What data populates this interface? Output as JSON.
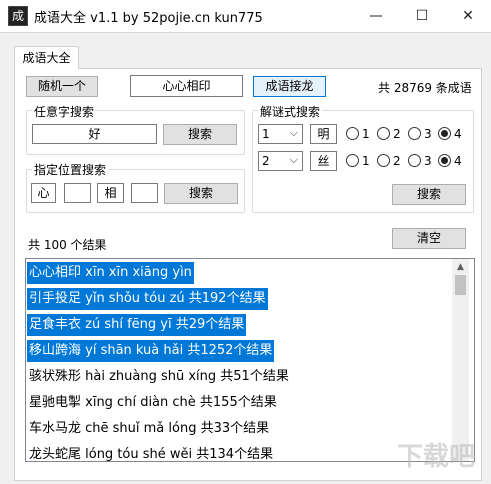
{
  "window": {
    "title": "成语大全 v1.1 by 52pojie.cn kun775",
    "icon_glyph": "成"
  },
  "tab": {
    "label": "成语大全"
  },
  "top": {
    "random_label": "随机一个",
    "current_idiom": "心心相印",
    "chain_label": "成语接龙",
    "total_text": "共 28769 条成语"
  },
  "any_char": {
    "title": "任意字搜索",
    "value": "好",
    "button": "搜索"
  },
  "position": {
    "title": "指定位置搜索",
    "slots": [
      "心",
      "",
      "相",
      ""
    ],
    "button": "搜索"
  },
  "riddle": {
    "title": "解谜式搜索",
    "rows": [
      {
        "count": "1",
        "char": "明",
        "options": [
          "1",
          "2",
          "3",
          "4"
        ],
        "selected": "4"
      },
      {
        "count": "2",
        "char": "丝",
        "options": [
          "1",
          "2",
          "3",
          "4"
        ],
        "selected": "4"
      }
    ],
    "button": "搜索"
  },
  "results": {
    "count_text": "共 100 个结果",
    "clear_label": "清空",
    "items": [
      {
        "text": "心心相印 xīn xīn xiāng yìn",
        "selected": true
      },
      {
        "text": "引手投足 yǐn shǒu tóu zú   共192个结果",
        "selected": true
      },
      {
        "text": "足食丰衣 zú shí fēng yī   共29个结果",
        "selected": true
      },
      {
        "text": "移山跨海 yí shān kuà hǎi   共1252个结果",
        "selected": true
      },
      {
        "text": "骇状殊形 hài zhuàng shū xíng   共51个结果",
        "selected": false
      },
      {
        "text": "星驰电掣 xīng chí diàn chè   共155个结果",
        "selected": false
      },
      {
        "text": "车水马龙 chē shuǐ mǎ lóng   共33个结果",
        "selected": false
      },
      {
        "text": "龙头蛇尾 lóng tóu shé wěi   共134个结果",
        "selected": false
      }
    ]
  },
  "watermark_text": "下载吧",
  "icons": {
    "minimize": "minimize-icon",
    "maximize": "maximize-icon",
    "close": "close-icon",
    "dropdown": "chevron-down-icon"
  }
}
